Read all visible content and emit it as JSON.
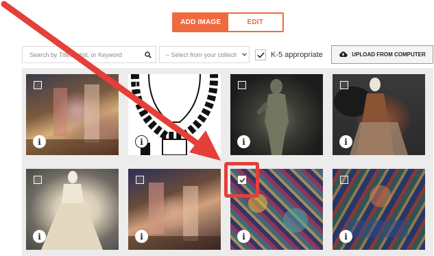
{
  "tabs": {
    "add_image": "ADD IMAGE",
    "edit": "EDIT"
  },
  "toolbar": {
    "search_placeholder": "Search by Title, Artist, or Keyword",
    "collection_select": "-- Select from your collecti",
    "k5_label": "K-5 appropriate",
    "k5_checked": true,
    "upload_label": "UPLOAD FROM COMPUTER"
  },
  "grid": {
    "tiles": [
      {
        "checked": false,
        "info": "i"
      },
      {
        "checked": false,
        "info": "i"
      },
      {
        "checked": false,
        "info": "i"
      },
      {
        "checked": false,
        "info": "i"
      },
      {
        "checked": false,
        "info": "i"
      },
      {
        "checked": false,
        "info": "i"
      },
      {
        "checked": true,
        "info": "i"
      },
      {
        "checked": false,
        "info": "i"
      }
    ]
  },
  "colors": {
    "accent": "#ef6a3f",
    "annotation": "#e53f3a"
  },
  "icons": [
    "search-icon",
    "chevron-down-icon",
    "checkmark-icon",
    "cloud-upload-icon",
    "info-icon"
  ]
}
